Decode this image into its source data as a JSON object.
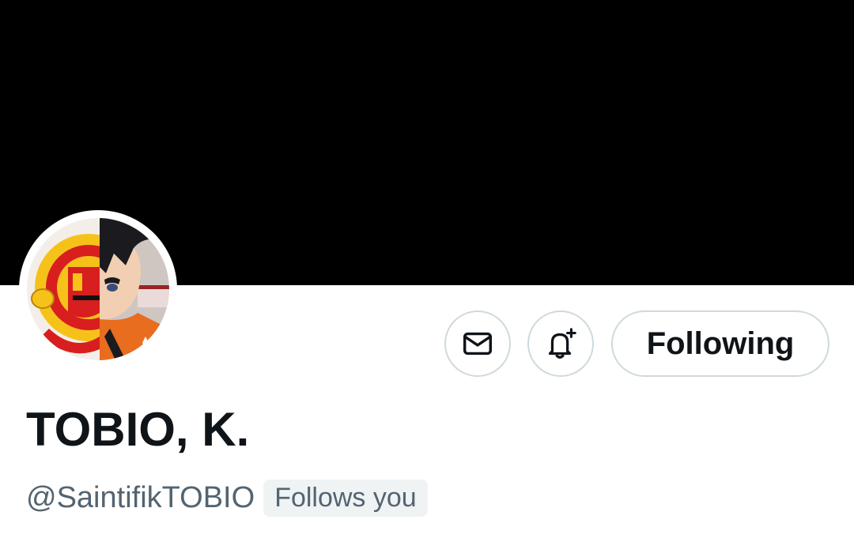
{
  "profile": {
    "display_name": "TOBIO, K.",
    "handle": "@SaintifikTOBIO",
    "follows_you_label": "Follows you",
    "avatar_name": "profile-avatar"
  },
  "actions": {
    "message_icon": "envelope-icon",
    "notify_icon": "bell-plus-icon",
    "following_label": "Following"
  },
  "colors": {
    "banner": "#000000",
    "text_primary": "#0f1419",
    "text_secondary": "#536471",
    "border": "#cfd9de",
    "badge_bg": "#eff3f4"
  }
}
